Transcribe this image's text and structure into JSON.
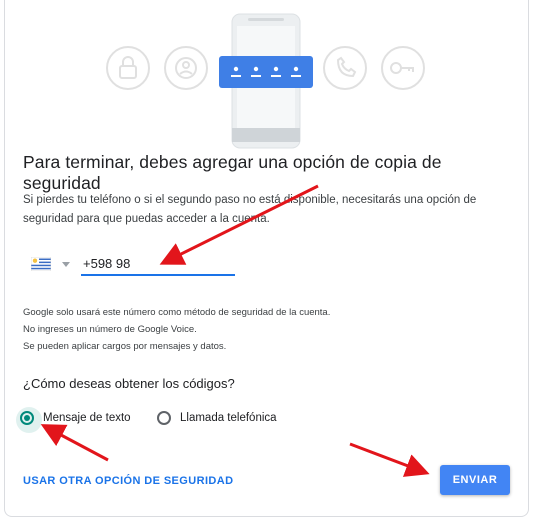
{
  "heading": "Para terminar, debes agregar una opción de copia de seguridad",
  "description": "Si pierdes tu teléfono o si el segundo paso no está disponible, necesitarás una opción de seguridad para que puedas acceder a la cuenta.",
  "phone": {
    "value": "+598 98",
    "country_flag": "uruguay-flag"
  },
  "notes": [
    "Google solo usará este número como método de seguridad de la cuenta.",
    "No ingreses un número de Google Voice.",
    "Se pueden aplicar cargos por mensajes y datos."
  ],
  "question": "¿Cómo deseas obtener los códigos?",
  "options": [
    {
      "label": "Mensaje de texto",
      "checked": true
    },
    {
      "label": "Llamada telefónica",
      "checked": false
    }
  ],
  "alt_link": "USAR OTRA OPCIÓN DE SEGURIDAD",
  "send_button": "ENVIAR",
  "hero": {
    "icons": [
      "lock-icon",
      "account-icon",
      "phone-icon",
      "key-icon"
    ],
    "code_card_color": "#3f7fe6",
    "code_dots": 4
  },
  "colors": {
    "accent": "#1a73e8",
    "radio_selected": "#00897b",
    "annotation_arrow": "#e2151b"
  }
}
